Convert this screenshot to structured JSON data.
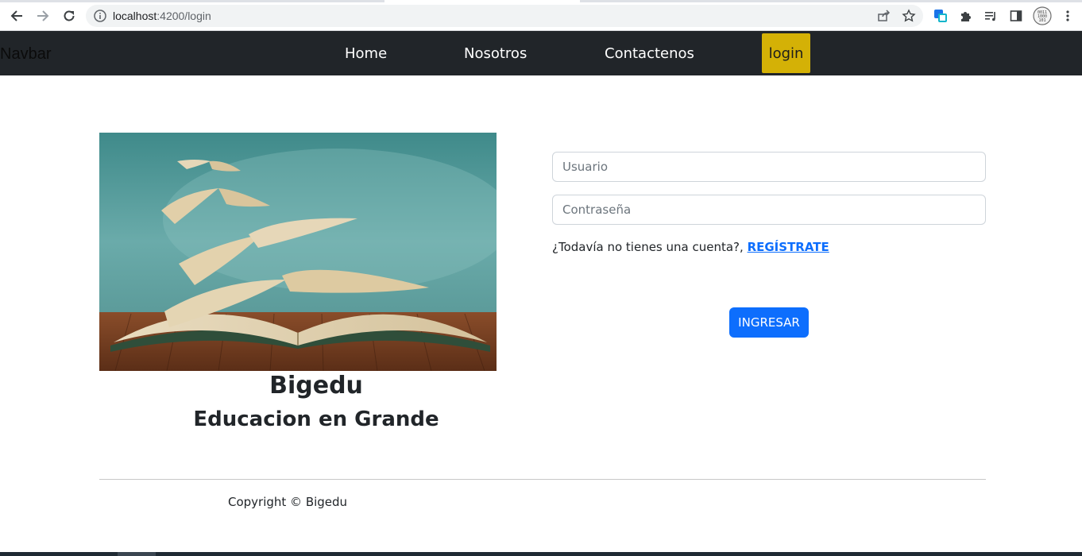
{
  "browser": {
    "url_host": "localhost",
    "url_path": ":4200/login",
    "icons": [
      "back-icon",
      "forward-icon",
      "reload-icon",
      "info-icon",
      "share-icon",
      "star-icon",
      "extension-translate-icon",
      "puzzle-icon",
      "media-list-icon",
      "side-panel-icon",
      "binary-extension-icon",
      "kebab-menu-icon"
    ]
  },
  "navbar": {
    "brand": "Navbar",
    "links": [
      "Home",
      "Nosotros",
      "Contactenos"
    ],
    "login": "login",
    "login_color": "#d4b106",
    "bg_color": "#212529"
  },
  "hero": {
    "title": "Bigedu",
    "subtitle": "Educacion en Grande"
  },
  "form": {
    "user_placeholder": "Usuario",
    "password_placeholder": "Contraseña",
    "signup_prompt": "¿Todavía no tienes una cuenta?,",
    "signup_link": "REGÍSTRATE",
    "submit": "INGRESAR",
    "accent_color": "#0d6efd"
  },
  "footer": {
    "copyright": "Copyright © Bigedu"
  }
}
